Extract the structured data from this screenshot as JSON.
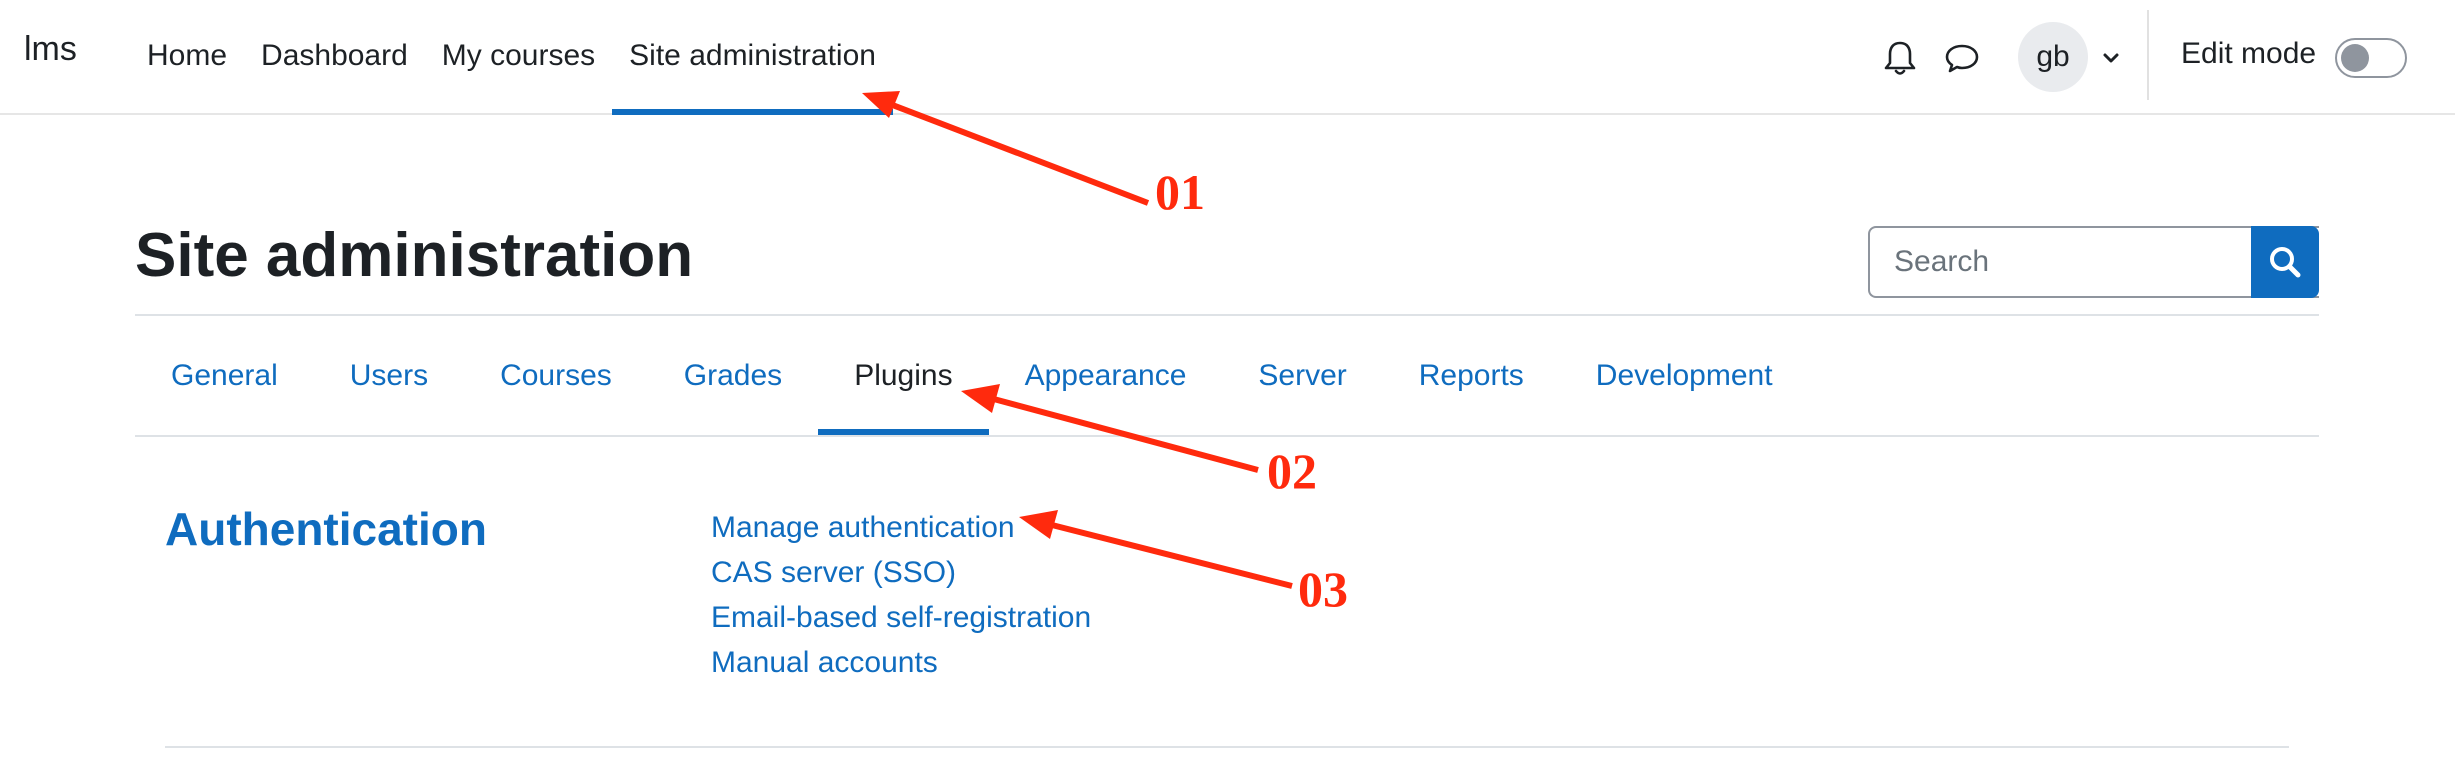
{
  "navbar": {
    "brand": "lms",
    "items": [
      {
        "label": "Home"
      },
      {
        "label": "Dashboard"
      },
      {
        "label": "My courses"
      },
      {
        "label": "Site administration"
      }
    ],
    "active_index": 3,
    "user_initials": "gb",
    "edit_mode_label": "Edit mode",
    "edit_mode_on": false,
    "icons": [
      "bell-icon",
      "chat-bubble-icon",
      "chevron-down-icon"
    ]
  },
  "header": {
    "title": "Site administration",
    "search_placeholder": "Search"
  },
  "tabs": {
    "items": [
      {
        "label": "General"
      },
      {
        "label": "Users"
      },
      {
        "label": "Courses"
      },
      {
        "label": "Grades"
      },
      {
        "label": "Plugins"
      },
      {
        "label": "Appearance"
      },
      {
        "label": "Server"
      },
      {
        "label": "Reports"
      },
      {
        "label": "Development"
      }
    ],
    "active_index": 4
  },
  "section": {
    "heading": "Authentication",
    "links": [
      {
        "label": "Manage authentication"
      },
      {
        "label": "CAS server (SSO)"
      },
      {
        "label": "Email-based self-registration"
      },
      {
        "label": "Manual accounts"
      }
    ]
  },
  "annotations": [
    {
      "label": "01"
    },
    {
      "label": "02"
    },
    {
      "label": "03"
    }
  ],
  "colors": {
    "brand_blue": "#0f6cbf",
    "annotation_red": "#ff2a0d",
    "text_dark": "#1d2125"
  }
}
